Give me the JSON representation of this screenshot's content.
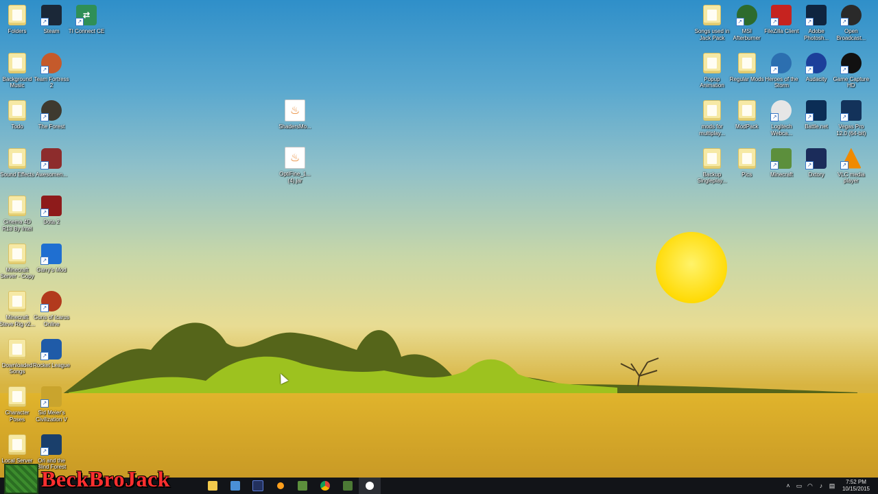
{
  "desktop": {
    "left_column": [
      {
        "label": "Folders",
        "icon": "folder-icon",
        "kind": "folder"
      },
      {
        "label": "Background Music",
        "icon": "folder-icon",
        "kind": "folder"
      },
      {
        "label": "Todo",
        "icon": "folder-icon",
        "kind": "folder"
      },
      {
        "label": "Sound Effects",
        "icon": "folder-icon",
        "kind": "folder"
      },
      {
        "label": "Cinema 4D R13 By Intel",
        "icon": "folder-icon",
        "kind": "folder"
      },
      {
        "label": "Minecraft Server - Copy",
        "icon": "folder-icon",
        "kind": "folder"
      },
      {
        "label": "Minecraft Steve Rig v2...",
        "icon": "folder-icon",
        "kind": "folder"
      },
      {
        "label": "Downloaded Songs",
        "icon": "folder-icon",
        "kind": "folder"
      },
      {
        "label": "Character Poses",
        "icon": "folder-icon",
        "kind": "folder"
      },
      {
        "label": "Local Server",
        "icon": "folder-icon",
        "kind": "folder"
      }
    ],
    "second_column": [
      {
        "label": "Steam",
        "icon": "steam-icon"
      },
      {
        "label": "Team Fortress 2",
        "icon": "tf2-icon"
      },
      {
        "label": "The Forest",
        "icon": "forest-icon"
      },
      {
        "label": "Awesomen...",
        "icon": "awesomenauts-icon"
      },
      {
        "label": "Dota 2",
        "icon": "dota2-icon"
      },
      {
        "label": "Garry's Mod",
        "icon": "gmod-icon"
      },
      {
        "label": "Guns of Icarus Online",
        "icon": "gears-icon"
      },
      {
        "label": "Rocket League",
        "icon": "rocket-league-icon"
      },
      {
        "label": "Sid Meier's Civilization V",
        "icon": "civ5-icon"
      },
      {
        "label": "Ori and the Blind Forest",
        "icon": "ori-icon"
      }
    ],
    "third_column": [
      {
        "label": "TI Connect CE",
        "icon": "ti-connect-icon"
      }
    ],
    "middle_files": [
      {
        "label": "ShadersMo...",
        "icon": "java-file-icon"
      },
      {
        "label": "OptiFine_1... (4).jar",
        "icon": "java-file-icon"
      }
    ],
    "right_grid": [
      {
        "label": "Songs used in Jack Pack",
        "icon": "folder-icon"
      },
      {
        "label": "MSI Afterburner",
        "icon": "afterburner-icon"
      },
      {
        "label": "FileZilla Client",
        "icon": "filezilla-icon"
      },
      {
        "label": "Adobe Photosh...",
        "icon": "photoshop-icon"
      },
      {
        "label": "Open Broadcast...",
        "icon": "obs-icon"
      },
      {
        "label": "Popup Animation",
        "icon": "folder-icon"
      },
      {
        "label": "Regular Mods",
        "icon": "folder-icon"
      },
      {
        "label": "Heroes of the Storm",
        "icon": "hots-icon"
      },
      {
        "label": "Audacity",
        "icon": "audacity-icon"
      },
      {
        "label": "Game Capture HD",
        "icon": "game-capture-icon"
      },
      {
        "label": "mods for multiplay...",
        "icon": "folder-icon"
      },
      {
        "label": "ModPack",
        "icon": "folder-icon"
      },
      {
        "label": "Logitech Webca...",
        "icon": "webcam-icon"
      },
      {
        "label": "Battle.net",
        "icon": "battlenet-icon"
      },
      {
        "label": "Vegas Pro 12.0 (64-bit)",
        "icon": "vegas-icon"
      },
      {
        "label": "Backup Singleplay...",
        "icon": "folder-icon"
      },
      {
        "label": "Pics",
        "icon": "folder-icon"
      },
      {
        "label": "Minecraft",
        "icon": "minecraft-icon"
      },
      {
        "label": "Dxtory",
        "icon": "dxtory-icon"
      },
      {
        "label": "VLC media player",
        "icon": "vlc-icon"
      }
    ]
  },
  "watermark": {
    "text": "BeckBroJack"
  },
  "taskbar": {
    "pinned": [
      "file-explorer-icon",
      "app-icon-2",
      "app-icon-3",
      "app-icon-4",
      "minecraft-icon",
      "chrome-icon",
      "minecraft-icon-2",
      "obs-icon"
    ],
    "clock_time": "7:52 PM",
    "clock_date": "10/15/2015"
  },
  "colors": {
    "sky_top": "#2f8fc9",
    "sand": "#d8b441",
    "hills": "#8fae1f",
    "sun": "#ffe81a",
    "taskbar": "#121418"
  }
}
